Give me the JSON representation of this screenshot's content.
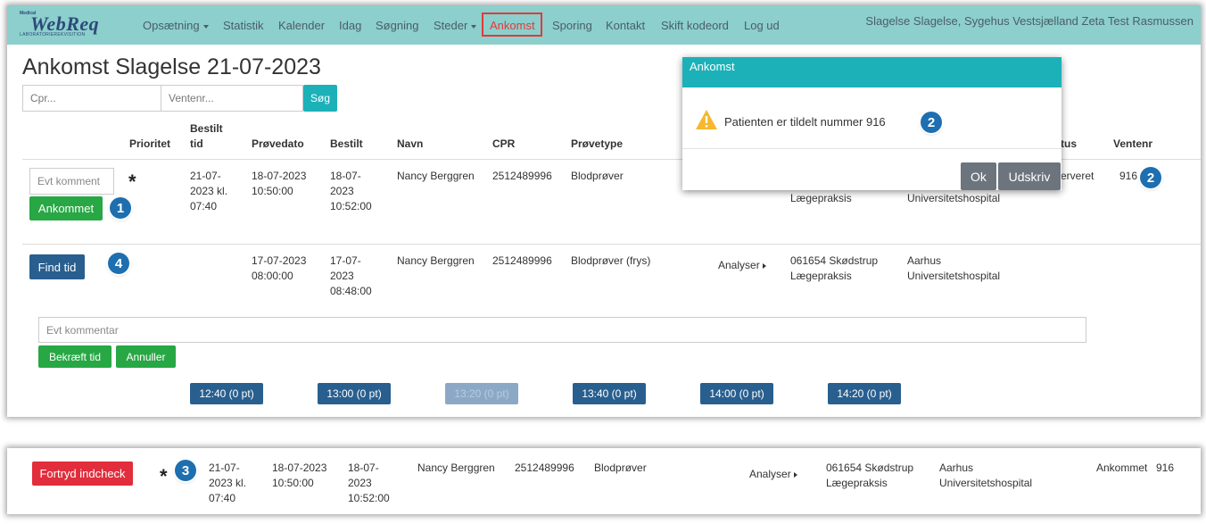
{
  "nav": {
    "logo_top": "Medical",
    "logo_main": "WebReq",
    "logo_sub": "LABORATORIEREKVISITION",
    "items": [
      "Opsætning",
      "Statistik",
      "Kalender",
      "Idag",
      "Søgning",
      "Steder",
      "Ankomst",
      "Sporing",
      "Kontakt",
      "Skift kodeord",
      "Log ud"
    ],
    "user": "Slagelse Slagelse, Sygehus Vestsjælland Zeta Test Rasmussen"
  },
  "page": {
    "title": "Ankomst Slagelse 21-07-2023"
  },
  "search": {
    "cpr_placeholder": "Cpr...",
    "ventenr_placeholder": "Ventenr...",
    "button": "Søg"
  },
  "table": {
    "headers": {
      "prioritet": "Prioritet",
      "bestilt_tid_1": "Bestilt",
      "bestilt_tid_2": "tid",
      "provedato": "Prøvedato",
      "bestilt": "Bestilt",
      "navn": "Navn",
      "cpr": "CPR",
      "provetype": "Prøvetype",
      "status": "tus",
      "ventenr": "Ventenr"
    },
    "row1": {
      "comment_placeholder": "Evt komment",
      "button": "Ankommet",
      "prioritet": "*",
      "bestilt_tid": [
        "21-07-",
        "2023 kl.",
        "07:40"
      ],
      "provedato": [
        "18-07-2023",
        "10:50:00"
      ],
      "bestilt": [
        "18-07-",
        "2023",
        "10:52:00"
      ],
      "navn": "Nancy Berggren",
      "cpr": "2512489996",
      "provetype": "Blodprøver",
      "rekv": "Lægepraksis",
      "sted": "Universitetshospital",
      "status": "erveret",
      "ventenr": "916"
    },
    "row2": {
      "button": "Find tid",
      "provedato": [
        "17-07-2023",
        "08:00:00"
      ],
      "bestilt": [
        "17-07-",
        "2023",
        "08:48:00"
      ],
      "navn": "Nancy Berggren",
      "cpr": "2512489996",
      "provetype": "Blodprøver (frys)",
      "analyser": "Analyser",
      "rekv": [
        "061654 Skødstrup",
        "Lægepraksis"
      ],
      "sted": [
        "Aarhus",
        "Universitetshospital"
      ]
    },
    "booking": {
      "comment_placeholder": "Evt kommentar",
      "confirm": "Bekræft tid",
      "cancel": "Annuller",
      "slots": [
        "12:40 (0 pt)",
        "13:00 (0 pt)",
        "13:20 (0 pt)",
        "13:40 (0 pt)",
        "14:00 (0 pt)",
        "14:20 (0 pt)"
      ]
    }
  },
  "modal": {
    "title": "Ankomst",
    "message": "Patienten er tildelt nummer 916",
    "ok": "Ok",
    "print": "Udskriv"
  },
  "row3": {
    "button": "Fortryd indcheck",
    "prioritet": "*",
    "bestilt_tid": [
      "21-07-",
      "2023 kl.",
      "07:40"
    ],
    "provedato": [
      "18-07-2023",
      "10:50:00"
    ],
    "bestilt": [
      "18-07-",
      "2023",
      "10:52:00"
    ],
    "navn": "Nancy Berggren",
    "cpr": "2512489996",
    "provetype": "Blodprøver",
    "analyser": "Analyser",
    "rekv": [
      "061654 Skødstrup",
      "Lægepraksis"
    ],
    "sted": [
      "Aarhus",
      "Universitetshospital"
    ],
    "status": "Ankommet",
    "ventenr": "916"
  },
  "badges": [
    "1",
    "2",
    "2",
    "3",
    "4"
  ],
  "colors": {
    "navbar": "#8ccfcc",
    "teal": "#1cb1b8",
    "green": "#28a745",
    "blue": "#285f8f",
    "red": "#e12d3c",
    "badge": "#1d6fb0",
    "highlight": "#e03a3a"
  },
  "icons": {
    "warning": "warning-icon",
    "caret": "caret-down-icon",
    "analyser": "caret-right-icon"
  }
}
